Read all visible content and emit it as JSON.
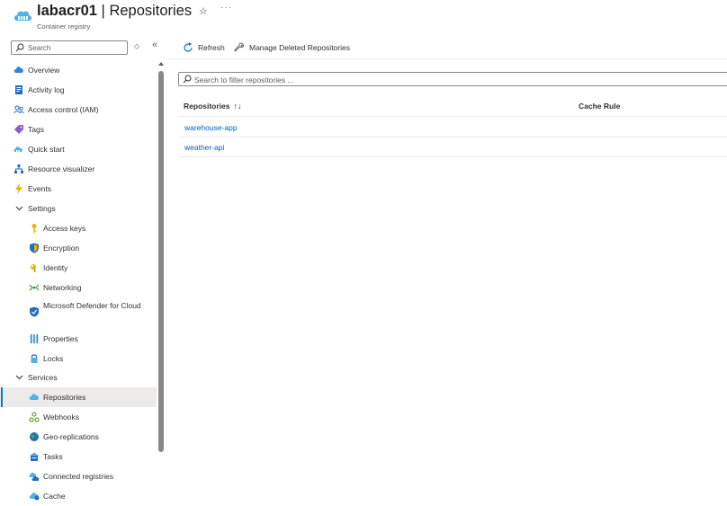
{
  "header": {
    "resource_name": "labacr01",
    "separator": " | ",
    "page_title": "Repositories",
    "subtitle": "Container registry",
    "favorite_icon": "star-icon",
    "more_label": "···"
  },
  "sidebar": {
    "search_placeholder": "Search",
    "items": [
      {
        "label": "Overview",
        "icon": "cloud-icon"
      },
      {
        "label": "Activity log",
        "icon": "activity-log-icon"
      },
      {
        "label": "Access control (IAM)",
        "icon": "people-icon"
      },
      {
        "label": "Tags",
        "icon": "tag-icon"
      },
      {
        "label": "Quick start",
        "icon": "quickstart-icon"
      },
      {
        "label": "Resource visualizer",
        "icon": "hierarchy-icon"
      },
      {
        "label": "Events",
        "icon": "lightning-icon"
      },
      {
        "label": "Settings",
        "icon": "chevron-down-icon"
      },
      {
        "label": "Access keys",
        "icon": "key-icon"
      },
      {
        "label": "Encryption",
        "icon": "shield-icon"
      },
      {
        "label": "Identity",
        "icon": "identity-icon"
      },
      {
        "label": "Networking",
        "icon": "network-icon"
      },
      {
        "label": "Microsoft Defender for Cloud",
        "icon": "defender-shield-icon"
      },
      {
        "label": "Properties",
        "icon": "properties-icon"
      },
      {
        "label": "Locks",
        "icon": "lock-icon"
      },
      {
        "label": "Services",
        "icon": "chevron-down-icon"
      },
      {
        "label": "Repositories",
        "icon": "repository-cloud-icon"
      },
      {
        "label": "Webhooks",
        "icon": "webhook-icon"
      },
      {
        "label": "Geo-replications",
        "icon": "globe-icon"
      },
      {
        "label": "Tasks",
        "icon": "tasks-icon"
      },
      {
        "label": "Connected registries",
        "icon": "connected-registry-icon"
      },
      {
        "label": "Cache",
        "icon": "cache-icon"
      }
    ]
  },
  "toolbar": {
    "refresh_label": "Refresh",
    "manage_deleted_label": "Manage Deleted Repositories"
  },
  "filter": {
    "placeholder": "Search to filter repositories ..."
  },
  "table": {
    "columns": [
      "Repositories",
      "Cache Rule"
    ],
    "sort_glyph": "↑↓",
    "rows": [
      {
        "name": "warehouse-app",
        "cache_rule": ""
      },
      {
        "name": "weather-api",
        "cache_rule": ""
      }
    ]
  },
  "colors": {
    "accent": "#0078d4",
    "link": "#0062c3",
    "active_bg": "#edebe9"
  }
}
